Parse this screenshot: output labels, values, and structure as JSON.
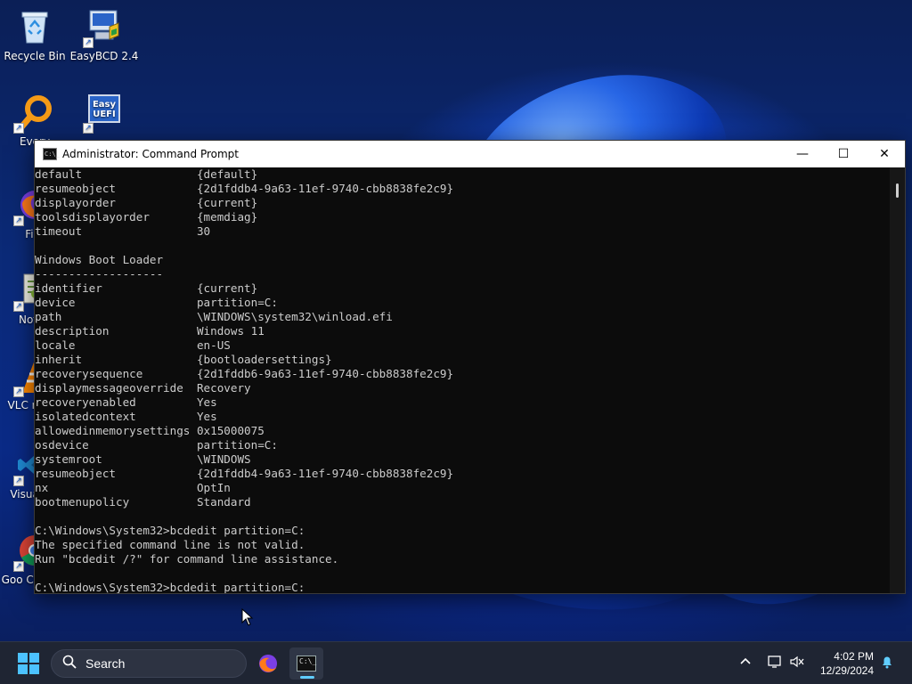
{
  "desktop": {
    "icons": [
      {
        "name": "recycle-bin",
        "label": "Recycle Bin"
      },
      {
        "name": "easybcd",
        "label": "EasyBCD 2.4"
      },
      {
        "name": "everything",
        "label": "Every"
      },
      {
        "name": "easyuefi",
        "label": "",
        "badge": "Easy UEFI"
      },
      {
        "name": "firefox",
        "label": "Fire"
      },
      {
        "name": "notepad",
        "label": "Notep"
      },
      {
        "name": "vlc",
        "label": "VLC m pla"
      },
      {
        "name": "visual-studio-code",
        "label": "Visual Co"
      },
      {
        "name": "google-chrome",
        "label": "Goo Chrome"
      }
    ]
  },
  "window": {
    "title": "Administrator: Command Prompt",
    "icon_text": "C:\\_",
    "minimize": "—",
    "maximize": "☐",
    "close": "✕"
  },
  "console": {
    "lines": [
      "default                 {default}",
      "resumeobject            {2d1fddb4-9a63-11ef-9740-cbb8838fe2c9}",
      "displayorder            {current}",
      "toolsdisplayorder       {memdiag}",
      "timeout                 30",
      "",
      "Windows Boot Loader",
      "-------------------",
      "identifier              {current}",
      "device                  partition=C:",
      "path                    \\WINDOWS\\system32\\winload.efi",
      "description             Windows 11",
      "locale                  en-US",
      "inherit                 {bootloadersettings}",
      "recoverysequence        {2d1fddb6-9a63-11ef-9740-cbb8838fe2c9}",
      "displaymessageoverride  Recovery",
      "recoveryenabled         Yes",
      "isolatedcontext         Yes",
      "allowedinmemorysettings 0x15000075",
      "osdevice                partition=C:",
      "systemroot              \\WINDOWS",
      "resumeobject            {2d1fddb4-9a63-11ef-9740-cbb8838fe2c9}",
      "nx                      OptIn",
      "bootmenupolicy          Standard",
      "",
      "C:\\Windows\\System32>bcdedit partition=C:",
      "The specified command line is not valid.",
      "Run \"bcdedit /?\" for command line assistance.",
      "",
      "C:\\Windows\\System32>bcdedit partition=C:"
    ]
  },
  "taskbar": {
    "search_label": "Search",
    "time": "4:02 PM",
    "date": "12/29/2024"
  },
  "colors": {
    "accent": "#4cc2ff",
    "console_bg": "#0c0c0c",
    "console_fg": "#cccccc",
    "taskbar_bg": "#1f2533"
  }
}
